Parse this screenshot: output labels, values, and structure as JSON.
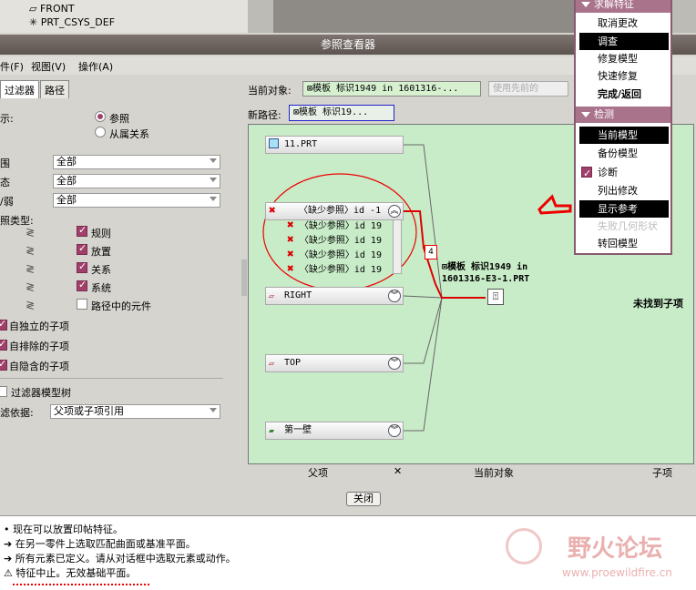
{
  "tree": {
    "items": [
      "FRONT",
      "PRT_CSYS_DEF"
    ]
  },
  "window": {
    "title": "参照查看器"
  },
  "menubar": {
    "file": "件(F)",
    "view": "视图(V)",
    "ops": "操作(A)"
  },
  "tabs": {
    "filter": "过滤器",
    "path": "路径"
  },
  "left": {
    "show_label": "示:",
    "show_options": [
      "参照",
      "从属关系"
    ],
    "range_label": "围",
    "range_value": "全部",
    "state_label": "态",
    "state_value": "全部",
    "strength_label": "/弱",
    "strength_value": "全部",
    "reftype_label": "照类型:",
    "types": [
      "规则",
      "放置",
      "关系",
      "系统",
      "路径中的元件"
    ],
    "children": [
      "自独立的子项",
      "自排除的子项",
      "自隐含的子项"
    ],
    "filter_tree": "过滤器模型树",
    "basis_label": "滤依据:",
    "basis_value": "父项或子项引用"
  },
  "current": {
    "label": "当前对象:",
    "value": "⊠模板 标识1949 in 1601316-...",
    "prev": "使用先前的"
  },
  "newpath": {
    "label": "新路径:",
    "value": "⊠模板 标识19..."
  },
  "graph": {
    "nodes": [
      "11.PRT",
      "〈缺少参照〉id -1",
      "RIGHT",
      "TOP",
      "第一壁"
    ],
    "missing": [
      "〈缺少参照〉id 19",
      "〈缺少参照〉id 19",
      "〈缺少参照〉id 19",
      "〈缺少参照〉id 19"
    ],
    "count": "4",
    "center": "⊠模板 标识1949 in 1601316-E3-1.PRT",
    "nochild": "未找到子项"
  },
  "columns": {
    "parent": "父项",
    "current": "当前对象",
    "child": "子项"
  },
  "close": "关闭",
  "messages": [
    "• 现在可以放置印帖特征。",
    "➔ 在另一零件上选取匹配曲面或基准平面。",
    "➔ 所有元素已定义。请从对话框中选取元素或动作。",
    "⚠ 特征中止。无效基础平面。"
  ],
  "menu": {
    "head1": "求解特征",
    "items1": [
      "取消更改",
      "调查",
      "修复模型",
      "快速修复",
      "完成/返回"
    ],
    "head2": "检测",
    "items2": [
      "当前模型",
      "备份模型",
      "诊断",
      "列出修改",
      "显示参考",
      "失败几何形状",
      "转回模型"
    ]
  },
  "watermark": {
    "title": "野火论坛",
    "url": "www.proewildfire.cn"
  },
  "colors": {
    "accent": "#a0406a",
    "graph_bg": "#c8ecc8",
    "annot": "#e00000"
  }
}
